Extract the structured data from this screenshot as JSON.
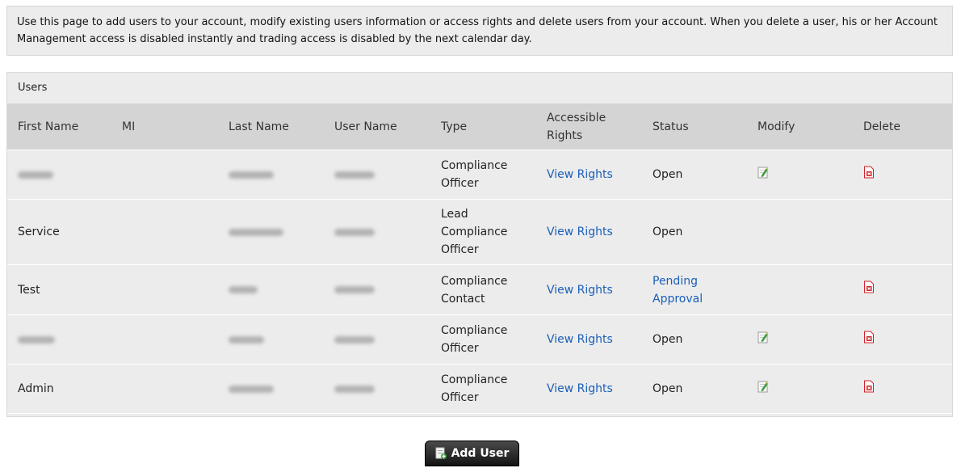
{
  "intro": "Use this page to add users to your account, modify existing users information or access rights and delete users from your account. When you delete a user, his or her Account Management access is disabled instantly and trading access is disabled by the next calendar day.",
  "users": {
    "title": "Users",
    "columns": {
      "first": "First Name",
      "mi": "MI",
      "last": "Last Name",
      "user": "User Name",
      "type": "Type",
      "rights": "Accessible Rights",
      "status": "Status",
      "modify": "Modify",
      "delete": "Delete"
    },
    "rows": [
      {
        "first": "",
        "mi": "",
        "last": "",
        "user": "",
        "type": "Compliance Officer",
        "rights": "View Rights",
        "status": "Open",
        "status_link": false,
        "modify": true,
        "delete": true
      },
      {
        "first": "Service",
        "mi": "",
        "last": "",
        "user": "",
        "type": "Lead Compliance Officer",
        "rights": "View Rights",
        "status": "Open",
        "status_link": false,
        "modify": false,
        "delete": false
      },
      {
        "first": "Test",
        "mi": "",
        "last": "",
        "user": "",
        "type": "Compliance Contact",
        "rights": "View Rights",
        "status": "Pending Approval",
        "status_link": true,
        "modify": false,
        "delete": true
      },
      {
        "first": "",
        "mi": "",
        "last": "",
        "user": "",
        "type": "Compliance Officer",
        "rights": "View Rights",
        "status": "Open",
        "status_link": false,
        "modify": true,
        "delete": true
      },
      {
        "first": "Admin",
        "mi": "",
        "last": "",
        "user": "",
        "type": "Compliance Officer",
        "rights": "View Rights",
        "status": "Open",
        "status_link": false,
        "modify": true,
        "delete": true
      }
    ]
  },
  "add_user_label": "Add User",
  "icons": {
    "modify": "edit-icon",
    "delete": "delete-icon",
    "add": "add-user-icon"
  },
  "colors": {
    "link": "#1b5fb7",
    "header_bg": "#d4d4d4",
    "panel_bg": "#ececec",
    "delete": "#d0232a",
    "edit": "#3a9a3a"
  }
}
